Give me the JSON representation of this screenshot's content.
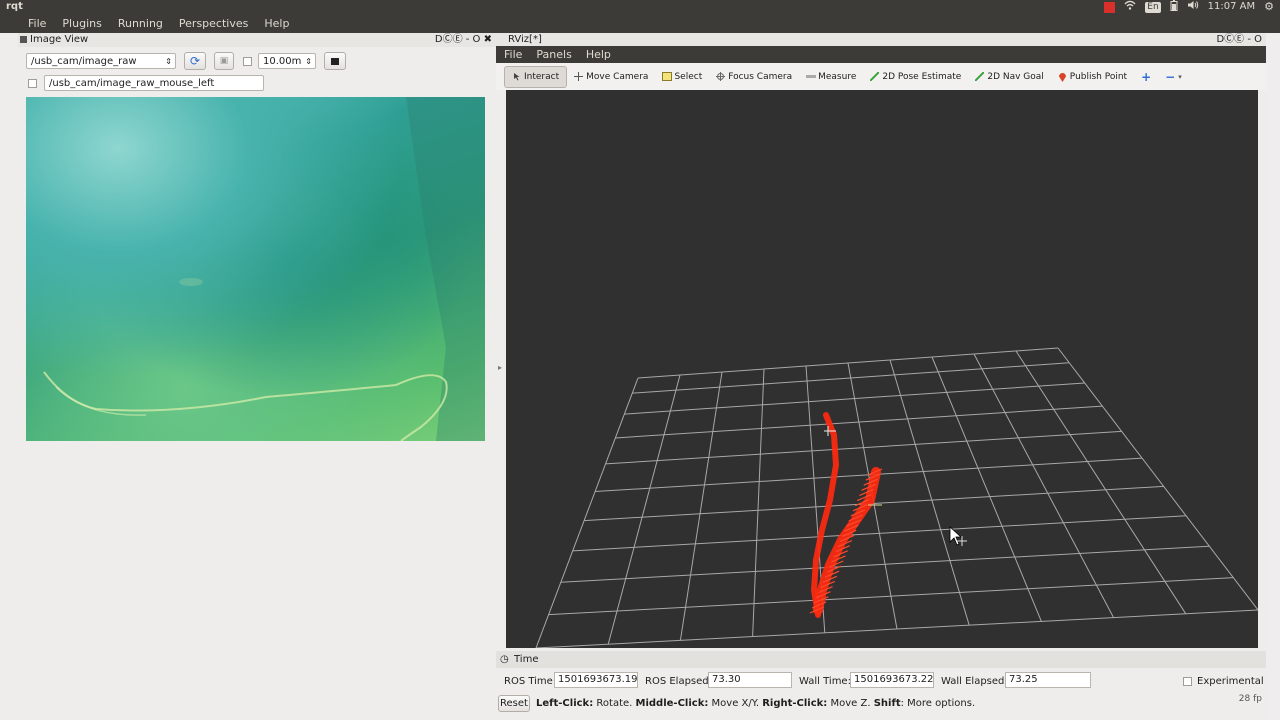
{
  "system_bar": {
    "app_title": "rqt",
    "keyboard_layout": "En",
    "clock": "11:07 AM"
  },
  "rqt_menu": [
    "File",
    "Plugins",
    "Running",
    "Perspectives",
    "Help"
  ],
  "image_view": {
    "dock_title": "Image View",
    "dock_controls": "DⒸⒺ - O ✖",
    "topic_combo": "/usb_cam/image_raw",
    "zoom_value": "10.00m",
    "mouse_topic": "/usb_cam/image_raw_mouse_left"
  },
  "rviz": {
    "dock_title": "RViz[*]",
    "dock_controls": "DⒸⒺ - O",
    "menu": [
      "File",
      "Panels",
      "Help"
    ],
    "tools": [
      {
        "label": "Interact",
        "icon": "interact-icon"
      },
      {
        "label": "Move Camera",
        "icon": "move-camera-icon"
      },
      {
        "label": "Select",
        "icon": "select-icon"
      },
      {
        "label": "Focus Camera",
        "icon": "focus-camera-icon"
      },
      {
        "label": "Measure",
        "icon": "measure-icon"
      },
      {
        "label": "2D Pose Estimate",
        "icon": "pose-estimate-icon"
      },
      {
        "label": "2D Nav Goal",
        "icon": "nav-goal-icon"
      },
      {
        "label": "Publish Point",
        "icon": "publish-point-icon"
      }
    ],
    "time_panel": {
      "title": "Time",
      "ros_time_label": "ROS Time:",
      "ros_time": "1501693673.19",
      "ros_elapsed_label": "ROS Elapsed:",
      "ros_elapsed": "73.30",
      "wall_time_label": "Wall Time:",
      "wall_time": "1501693673.22",
      "wall_elapsed_label": "Wall Elapsed:",
      "wall_elapsed": "73.25",
      "experimental_label": "Experimental"
    },
    "hint": {
      "reset_label": "Reset",
      "left_click": "Left-Click:",
      "left_click_desc": "Rotate.",
      "middle_click": "Middle-Click:",
      "middle_click_desc": "Move X/Y.",
      "right_click": "Right-Click:",
      "right_click_desc": "Move Z.",
      "shift": "Shift",
      "shift_desc": "More options.",
      "fps": "28 fp"
    }
  },
  "colors": {
    "titlebar": "#3c3b37",
    "viewport_bg": "#303030",
    "trajectory": "#ff2a10",
    "grid": "#a8a8a8"
  }
}
